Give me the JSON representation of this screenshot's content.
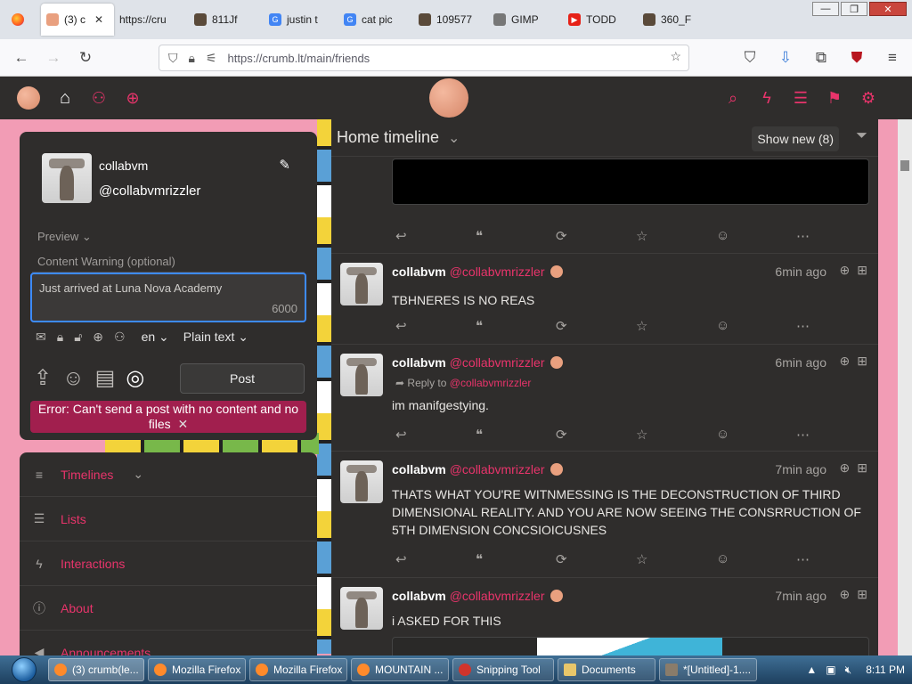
{
  "browser": {
    "tabs": [
      {
        "label": "(3) c",
        "active": true
      },
      {
        "label": "https://cru",
        "icon": "page-icon"
      },
      {
        "label": "811Jf",
        "icon": "image-icon"
      },
      {
        "label": "justin t",
        "icon": "google-icon"
      },
      {
        "label": "cat pic",
        "icon": "google-icon"
      },
      {
        "label": "109577",
        "icon": "image-icon"
      },
      {
        "label": "GIMP",
        "icon": "gimp-icon"
      },
      {
        "label": "TODD",
        "icon": "youtube-icon"
      },
      {
        "label": "360_F",
        "icon": "image-icon"
      }
    ],
    "url": "https://crumb.lt/main/friends",
    "window_controls": {
      "minimize": "—",
      "restore": "❐",
      "close": "✕"
    }
  },
  "composer": {
    "display_name": "collabvm",
    "handle": "@collabvmrizzler",
    "preview_label": "Preview",
    "content_warning_placeholder": "Content Warning (optional)",
    "status_text": "Just arrived at Luna Nova Academy",
    "char_counter": "6000",
    "language": "en",
    "format": "Plain text",
    "post_label": "Post",
    "error_text": "Error: Can't send a post with no content and no files",
    "error_close": "✕"
  },
  "side_menu": {
    "items": [
      {
        "label": "Timelines",
        "icon": "menu-icon"
      },
      {
        "label": "Lists",
        "icon": "list-icon"
      },
      {
        "label": "Interactions",
        "icon": "bolt-icon"
      },
      {
        "label": "About",
        "icon": "info-icon"
      },
      {
        "label": "Announcements",
        "icon": "megaphone-icon"
      }
    ]
  },
  "timeline": {
    "title": "Home timeline",
    "show_new_label": "Show new (8)",
    "posts": [
      {
        "name": "collabvm",
        "handle": "@collabvmrizzler",
        "time": "6min ago",
        "text": "TBHNERES IS NO REAS"
      },
      {
        "name": "collabvm",
        "handle": "@collabvmrizzler",
        "time": "6min ago",
        "reply_prefix": "Reply to",
        "reply_to": "@collabvmrizzler",
        "text": "im manifgestying."
      },
      {
        "name": "collabvm",
        "handle": "@collabvmrizzler",
        "time": "7min ago",
        "text": "THATS WHAT YOU'RE WITNMESSING IS THE DECONSTRUCTION OF THIRD DIMENSIONAL REALITY. AND YOU ARE NOW SEEING THE CONSRRUCTION OF 5TH DIMENSION CONCSIOICUSNES"
      },
      {
        "name": "collabvm",
        "handle": "@collabvmrizzler",
        "time": "7min ago",
        "text": "i ASKED FOR THIS"
      }
    ]
  },
  "taskbar": {
    "tasks": [
      {
        "label": "(3) crumb(le..."
      },
      {
        "label": "Mozilla Firefox"
      },
      {
        "label": "Mozilla Firefox"
      },
      {
        "label": "MOUNTAIN ..."
      },
      {
        "label": "Snipping Tool"
      },
      {
        "label": "Documents"
      },
      {
        "label": "*[Untitled]-1...."
      }
    ],
    "clock": "8:11 PM"
  },
  "colors": {
    "accent": "#e8346b",
    "panel": "#2f2d2c",
    "error": "#a11f4e",
    "focus": "#3d8bff"
  }
}
